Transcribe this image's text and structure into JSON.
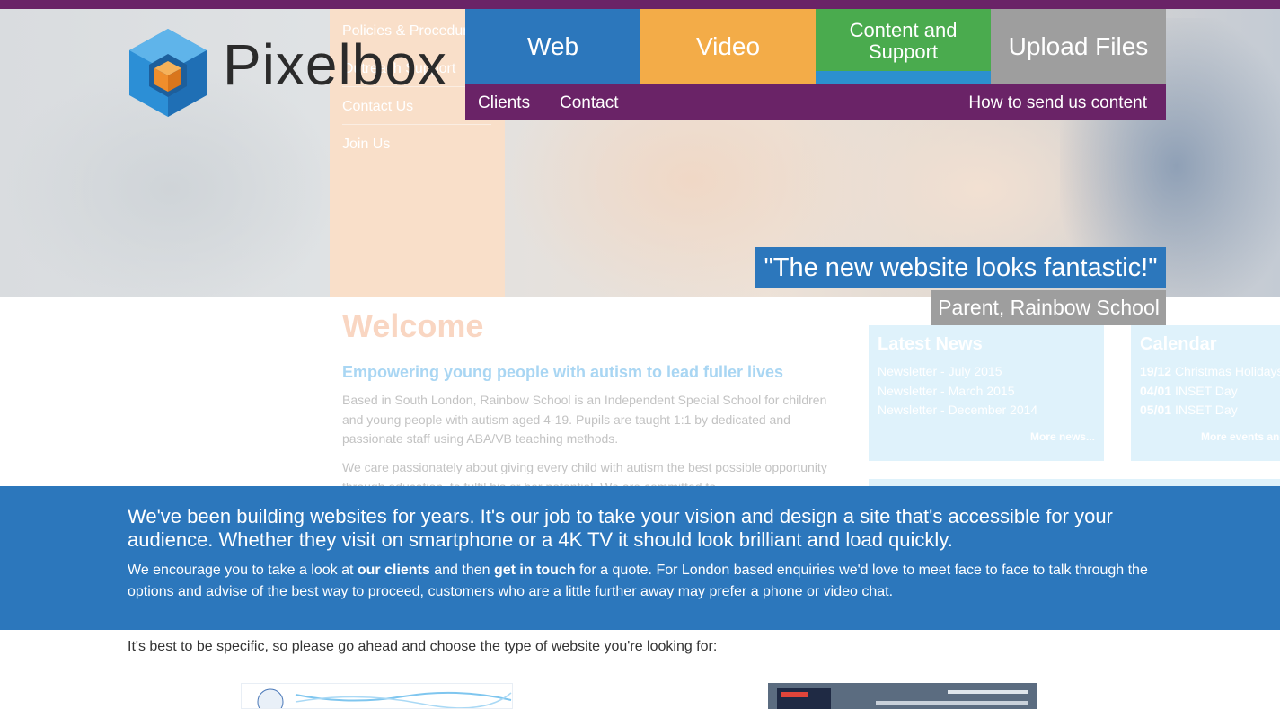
{
  "brand": {
    "name": "Pixelbox"
  },
  "nav": {
    "tabs": [
      {
        "label": "Web"
      },
      {
        "label": "Video"
      },
      {
        "label": "Content and Support"
      },
      {
        "label": "Upload Files"
      }
    ],
    "sub_links": [
      {
        "label": "Clients"
      },
      {
        "label": "Contact"
      }
    ],
    "sub_right": "How to send us content"
  },
  "preview": {
    "side_menu": [
      "Policies & Procedures",
      "Outreach Support",
      "Contact Us",
      "Join Us"
    ],
    "welcome": "Welcome",
    "tagline": "Empowering young people with autism to lead fuller lives",
    "para1": "Based in South London, Rainbow School is an Independent Special School for children and young people with autism aged 4-19. Pupils are taught 1:1 by dedicated and passionate staff using ABA/VB teaching methods.",
    "para2": "We care passionately about giving every child with autism the best possible opportunity through education, to fulfil his or her potential. We are committed to",
    "news": {
      "title": "Latest News",
      "items": [
        "Newsletter - July 2015",
        "Newsletter - March 2015",
        "Newsletter - December 2014"
      ],
      "more": "More news..."
    },
    "calendar": {
      "title": "Calendar",
      "items": [
        {
          "date": "19/12",
          "label": "Christmas Holidays"
        },
        {
          "date": "04/01",
          "label": "INSET Day"
        },
        {
          "date": "05/01",
          "label": "INSET Day"
        }
      ],
      "more": "More events and dates..."
    }
  },
  "testimonial": {
    "quote": "\"The new website looks fantastic!\"",
    "author": "Parent, Rainbow School"
  },
  "banner": {
    "lead": "We've been building websites for years. It's our job to take your vision and design a site that's accessible for your audience. Whether they visit on smartphone or a 4K TV it should look brilliant and load quickly.",
    "body_1": "We encourage you to take a look at ",
    "clients_link": "our clients",
    "body_2": " and then ",
    "touch_link": "get in touch",
    "body_3": " for a quote. For London based enquiries we'd love to meet face to face to talk through the options and advise of the best way to proceed, customers who are a little further away may prefer a phone or video chat."
  },
  "choose_text": "It's best to be specific, so please go ahead and choose the type of website you're looking for:",
  "colors": {
    "purple": "#6a2367",
    "blue": "#2c77bc",
    "orange": "#f3ac48",
    "green": "#4aab4e",
    "grey": "#9e9e9e"
  }
}
